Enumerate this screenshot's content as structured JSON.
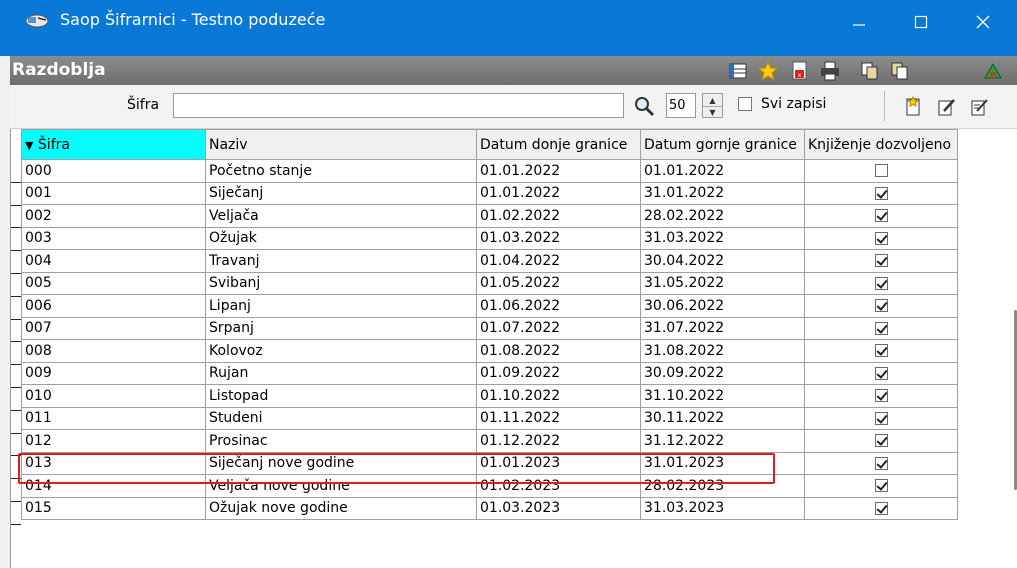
{
  "window": {
    "title": "Saop Šifrarnici - Testno poduzeće"
  },
  "header": {
    "title": "Razdoblja"
  },
  "search": {
    "label": "Šifra",
    "value": "",
    "limit": "50",
    "svi_zapisi_label": "Svi zapisi",
    "svi_zapisi_checked": false
  },
  "columns": [
    "Šifra",
    "Naziv",
    "Datum donje granice",
    "Datum gornje granice",
    "Knjiženje dozvoljeno"
  ],
  "sorted_column": "Šifra",
  "rows": [
    {
      "sifra": "000",
      "naziv": "Početno stanje",
      "od": "01.01.2022",
      "do": "01.01.2022",
      "knjizenje": false
    },
    {
      "sifra": "001",
      "naziv": "Siječanj",
      "od": "01.01.2022",
      "do": "31.01.2022",
      "knjizenje": true
    },
    {
      "sifra": "002",
      "naziv": "Veljača",
      "od": "01.02.2022",
      "do": "28.02.2022",
      "knjizenje": true
    },
    {
      "sifra": "003",
      "naziv": "Ožujak",
      "od": "01.03.2022",
      "do": "31.03.2022",
      "knjizenje": true
    },
    {
      "sifra": "004",
      "naziv": "Travanj",
      "od": "01.04.2022",
      "do": "30.04.2022",
      "knjizenje": true
    },
    {
      "sifra": "005",
      "naziv": "Svibanj",
      "od": "01.05.2022",
      "do": "31.05.2022",
      "knjizenje": true
    },
    {
      "sifra": "006",
      "naziv": "Lipanj",
      "od": "01.06.2022",
      "do": "30.06.2022",
      "knjizenje": true
    },
    {
      "sifra": "007",
      "naziv": "Srpanj",
      "od": "01.07.2022",
      "do": "31.07.2022",
      "knjizenje": true
    },
    {
      "sifra": "008",
      "naziv": "Kolovoz",
      "od": "01.08.2022",
      "do": "31.08.2022",
      "knjizenje": true
    },
    {
      "sifra": "009",
      "naziv": "Rujan",
      "od": "01.09.2022",
      "do": "30.09.2022",
      "knjizenje": true
    },
    {
      "sifra": "010",
      "naziv": "Listopad",
      "od": "01.10.2022",
      "do": "31.10.2022",
      "knjizenje": true
    },
    {
      "sifra": "011",
      "naziv": "Studeni",
      "od": "01.11.2022",
      "do": "30.11.2022",
      "knjizenje": true
    },
    {
      "sifra": "012",
      "naziv": "Prosinac",
      "od": "01.12.2022",
      "do": "31.12.2022",
      "knjizenje": true
    },
    {
      "sifra": "013",
      "naziv": "Siječanj nove godine",
      "od": "01.01.2023",
      "do": "31.01.2023",
      "knjizenje": true
    },
    {
      "sifra": "014",
      "naziv": "Veljača nove godine",
      "od": "01.02.2023",
      "do": "28.02.2023",
      "knjizenje": true
    },
    {
      "sifra": "015",
      "naziv": "Ožujak nove godine",
      "od": "01.03.2023",
      "do": "31.03.2023",
      "knjizenje": true
    }
  ],
  "highlighted_row": "012",
  "colors": {
    "titlebar": "#0a78d7",
    "sorted_header": "#00ffff",
    "highlight": "#e21a1a"
  }
}
